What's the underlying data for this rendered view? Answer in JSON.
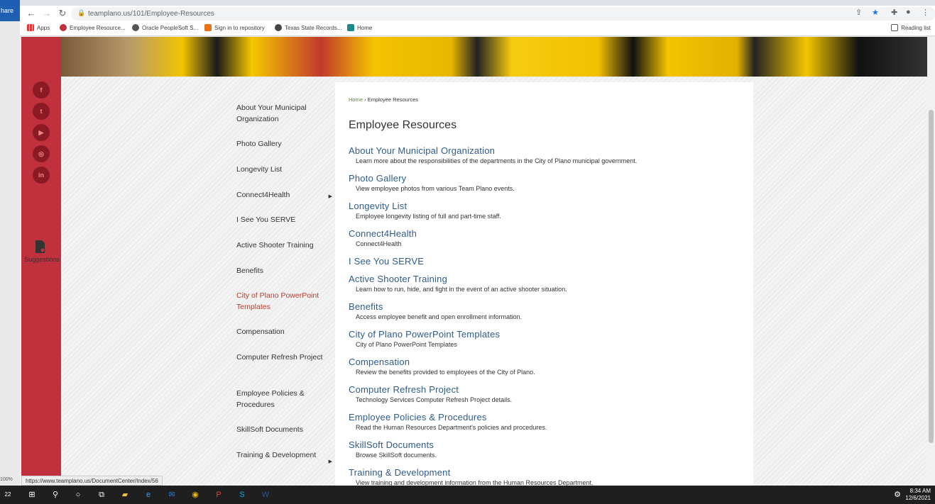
{
  "browser": {
    "share_tab": "hare",
    "url": "teamplano.us/101/Employee-Resources",
    "bookmarks": [
      "Apps",
      "Employee Resource...",
      "Oracle PeopleSoft S...",
      "Sign in to repository",
      "Texas State Records...",
      "Home"
    ],
    "reading_list": "Reading list",
    "status_url": "https://www.teamplano.us/DocumentCenter/Index/56",
    "zoom": "100%"
  },
  "rail": {
    "social": [
      "f",
      "t",
      "▶",
      "◎",
      "in"
    ],
    "suggestions": "Suggestions"
  },
  "sidenav": [
    {
      "label": "About Your Municipal Organization",
      "arrow": false,
      "active": false
    },
    {
      "label": "Photo Gallery",
      "arrow": false,
      "active": false
    },
    {
      "label": "Longevity List",
      "arrow": false,
      "active": false
    },
    {
      "label": "Connect4Health",
      "arrow": true,
      "active": false
    },
    {
      "label": "I See You SERVE",
      "arrow": false,
      "active": false
    },
    {
      "label": "Active Shooter Training",
      "arrow": false,
      "active": false
    },
    {
      "label": "Benefits",
      "arrow": false,
      "active": false
    },
    {
      "label": "City of Plano PowerPoint Templates",
      "arrow": false,
      "active": true
    },
    {
      "label": "Compensation",
      "arrow": false,
      "active": false
    },
    {
      "label": "Computer Refresh Project",
      "arrow": false,
      "active": false
    },
    {
      "label": "Employee Policies & Procedures",
      "arrow": false,
      "active": false
    },
    {
      "label": "SkillSoft Documents",
      "arrow": false,
      "active": false
    },
    {
      "label": "Training & Development",
      "arrow": true,
      "active": false
    }
  ],
  "content": {
    "breadcrumb_home": "Home",
    "breadcrumb_sep": "›",
    "breadcrumb_current": "Employee Resources",
    "title": "Employee Resources",
    "entries": [
      {
        "title": "About Your Municipal Organization",
        "desc": "Learn more about the responsibilities of the departments in the City of Plano municipal government."
      },
      {
        "title": "Photo Gallery",
        "desc": "View employee photos from various Team Plano events."
      },
      {
        "title": "Longevity List",
        "desc": "Employee longevity listing of full and part-time staff."
      },
      {
        "title": "Connect4Health",
        "desc": "Connect4Health"
      },
      {
        "title": "I See You SERVE",
        "desc": ""
      },
      {
        "title": "Active Shooter Training",
        "desc": "Learn how to run, hide, and fight in the event of an active shooter situation."
      },
      {
        "title": "Benefits",
        "desc": "Access employee benefit and open enrollment information."
      },
      {
        "title": "City of Plano PowerPoint Templates",
        "desc": "City of Plano PowerPoint Templates"
      },
      {
        "title": "Compensation",
        "desc": "Review the benefits provided to employees of the City of Plano."
      },
      {
        "title": "Computer Refresh Project",
        "desc": "Technology Services Computer Refresh Project details."
      },
      {
        "title": "Employee Policies & Procedures",
        "desc": "Read the Human Resources Department's policies and procedures."
      },
      {
        "title": "SkillSoft Documents",
        "desc": "Browse SkillSoft documents."
      },
      {
        "title": "Training & Development",
        "desc": "View training and development information from the Human Resources Department."
      }
    ]
  },
  "taskbar": {
    "time": "8:34 AM",
    "date": "12/6/2021",
    "badge": "22"
  }
}
